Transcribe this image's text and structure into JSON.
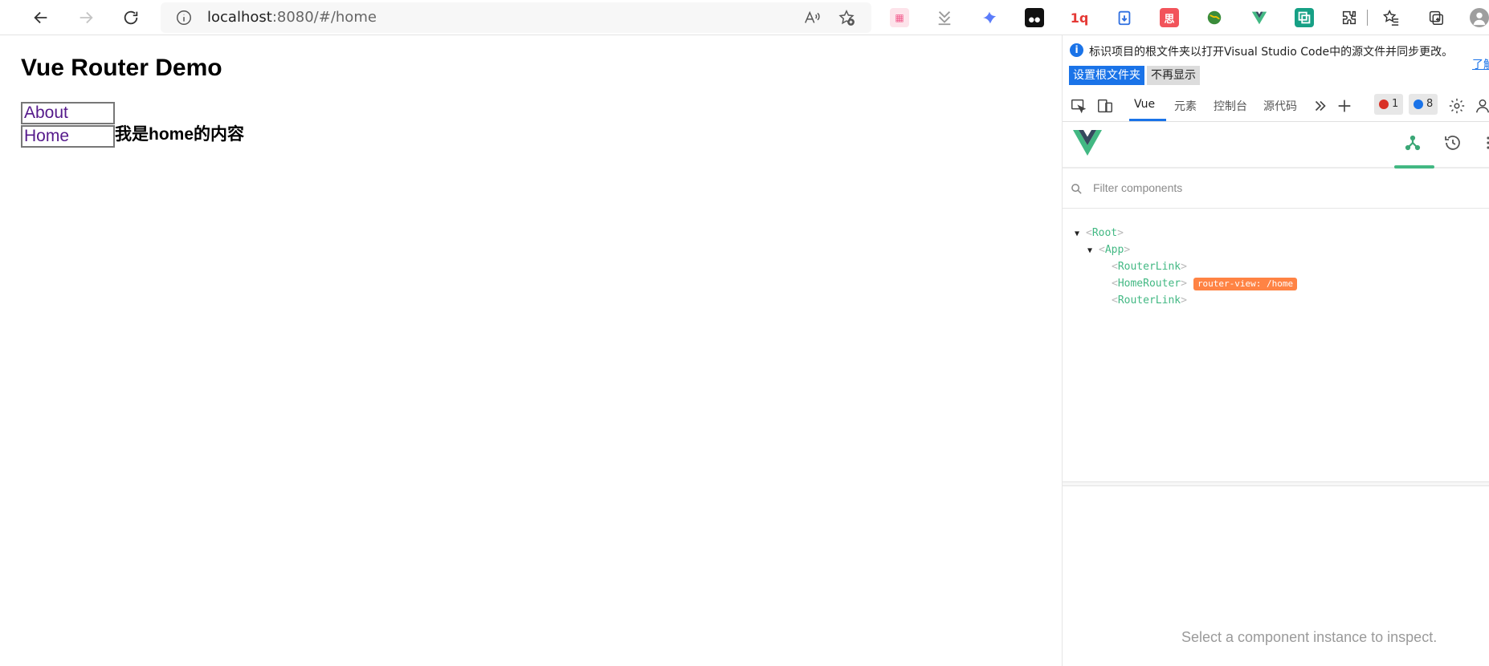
{
  "browser": {
    "url_host": "localhost",
    "url_path": ":8080/#/home"
  },
  "page": {
    "title": "Vue Router Demo",
    "links": [
      "About",
      "Home"
    ],
    "home_content": "我是home的内容"
  },
  "devtools": {
    "notice": {
      "text": "标识项目的根文件夹以打开Visual Studio Code中的源文件并同步更改。",
      "learn_more": "了解",
      "set_root_button": "设置根文件夹",
      "dont_show_button": "不再显示"
    },
    "tabs": [
      "Vue",
      "元素",
      "控制台",
      "源代码"
    ],
    "error_count": "1",
    "message_count": "8",
    "filter_placeholder": "Filter components",
    "tree": {
      "root": "Root",
      "app": "App",
      "router_link_1": "RouterLink",
      "home_router": "HomeRouter",
      "route_badge": "router-view: /home",
      "router_link_2": "RouterLink"
    },
    "inspect_message": "Select a component instance to inspect."
  },
  "colors": {
    "vue_green": "#42b883",
    "route_badge": "#ff8344",
    "link_visited": "#551a8b",
    "accent_blue": "#1a73e8"
  }
}
